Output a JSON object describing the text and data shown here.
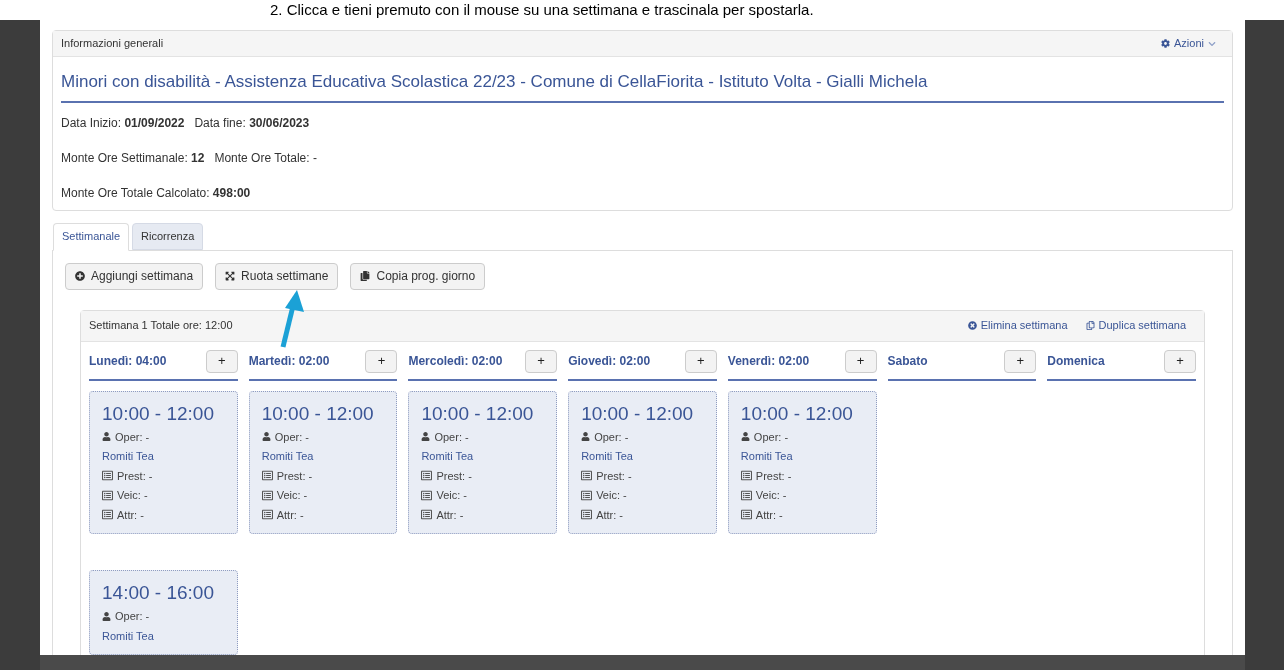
{
  "caption": "2. Clicca e tieni premuto con il mouse su una settimana e trascinala per spostarla.",
  "panel": {
    "title": "Informazioni generali",
    "action": "Azioni"
  },
  "heading": "Minori con disabilità - Assistenza Educativa Scolastica 22/23 - Comune di CellaFiorita - Istituto Volta - Gialli Michela",
  "info_lines": [
    "Data Inizio: **01/09/2022**   Data fine: **30/06/2023**",
    "Monte Ore Settimanale: **12**   Monte Ore Totale: -",
    "Monte Ore Totale Calcolato: **498:00**"
  ],
  "tabs": [
    {
      "label": "Settimanale",
      "selected": true
    },
    {
      "label": "Ricorrenza",
      "selected": false
    }
  ],
  "toolbar": [
    {
      "kind": "add",
      "label": "Aggiungi settimana"
    },
    {
      "kind": "rotate",
      "label": "Ruota settimane"
    },
    {
      "kind": "copy",
      "label": "Copia prog. giorno"
    }
  ],
  "week": {
    "title": "Settimana 1 Totale ore: 12:00",
    "actions": [
      {
        "kind": "delete",
        "label": "Elimina settimana"
      },
      {
        "kind": "duplicate",
        "label": "Duplica settimana"
      }
    ],
    "add_label": "+",
    "days": [
      {
        "label": "Lunedì: 04:00",
        "events": [
          {
            "time": "10:00 - 12:00",
            "operator": "Oper: -",
            "name": "Romiti Tea",
            "details": [
              "Prest: -",
              "Veic: -",
              "Attr: -"
            ]
          },
          {
            "time": "14:00 - 16:00",
            "operator": "Oper: -",
            "name": "Romiti Tea"
          }
        ]
      },
      {
        "label": "Martedì: 02:00",
        "events": [
          {
            "time": "10:00 - 12:00",
            "operator": "Oper: -",
            "name": "Romiti Tea",
            "details": [
              "Prest: -",
              "Veic: -",
              "Attr: -"
            ]
          }
        ]
      },
      {
        "label": "Mercoledì: 02:00",
        "events": [
          {
            "time": "10:00 - 12:00",
            "operator": "Oper: -",
            "name": "Romiti Tea",
            "details": [
              "Prest: -",
              "Veic: -",
              "Attr: -"
            ]
          }
        ]
      },
      {
        "label": "Giovedì: 02:00",
        "events": [
          {
            "time": "10:00 - 12:00",
            "operator": "Oper: -",
            "name": "Romiti Tea",
            "details": [
              "Prest: -",
              "Veic: -",
              "Attr: -"
            ]
          }
        ]
      },
      {
        "label": "Venerdì: 02:00",
        "events": [
          {
            "time": "10:00 - 12:00",
            "operator": "Oper: -",
            "name": "Romiti Tea",
            "details": [
              "Prest: -",
              "Veic: -",
              "Attr: -"
            ]
          }
        ]
      },
      {
        "label": "Sabato"
      },
      {
        "label": "Domenica"
      }
    ]
  }
}
